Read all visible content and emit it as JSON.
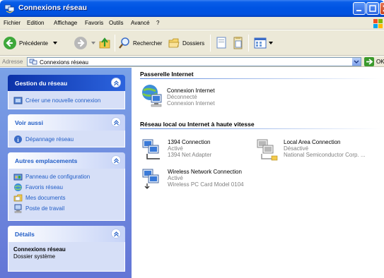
{
  "window": {
    "title": "Connexions réseau"
  },
  "menu": {
    "items": [
      "Fichier",
      "Edition",
      "Affichage",
      "Favoris",
      "Outils",
      "Avancé",
      "?"
    ]
  },
  "toolbar": {
    "back_label": "Précédente",
    "search_label": "Rechercher",
    "folders_label": "Dossiers"
  },
  "address": {
    "label": "Adresse",
    "value": "Connexions réseau",
    "go_label": "OK"
  },
  "tasks": {
    "network": {
      "title": "Gestion du réseau",
      "items": [
        "Créer une nouvelle connexion"
      ]
    },
    "see_also": {
      "title": "Voir aussi",
      "items": [
        "Dépannage réseau"
      ]
    },
    "other_places": {
      "title": "Autres emplacements",
      "items": [
        "Panneau de configuration",
        "Favoris réseau",
        "Mes documents",
        "Poste de travail"
      ]
    },
    "details": {
      "title": "Détails",
      "name": "Connexions réseau",
      "type": "Dossier système"
    }
  },
  "groups": {
    "gateway": {
      "title": "Passerelle Internet",
      "items": [
        {
          "name": "Connexion Internet",
          "status": "Déconnecté",
          "device": "Connexion Internet"
        }
      ]
    },
    "lan": {
      "title": "Réseau local ou Internet à haute vitesse",
      "items": [
        {
          "name": "1394 Connection",
          "status": "Activé",
          "device": "1394 Net Adapter"
        },
        {
          "name": "Local Area Connection",
          "status": "Désactivé",
          "device": "National Semiconductor Corp. ..."
        },
        {
          "name": "Wireless Network Connection",
          "status": "Activé",
          "device": "Wireless PC Card Model 0104"
        }
      ]
    }
  }
}
